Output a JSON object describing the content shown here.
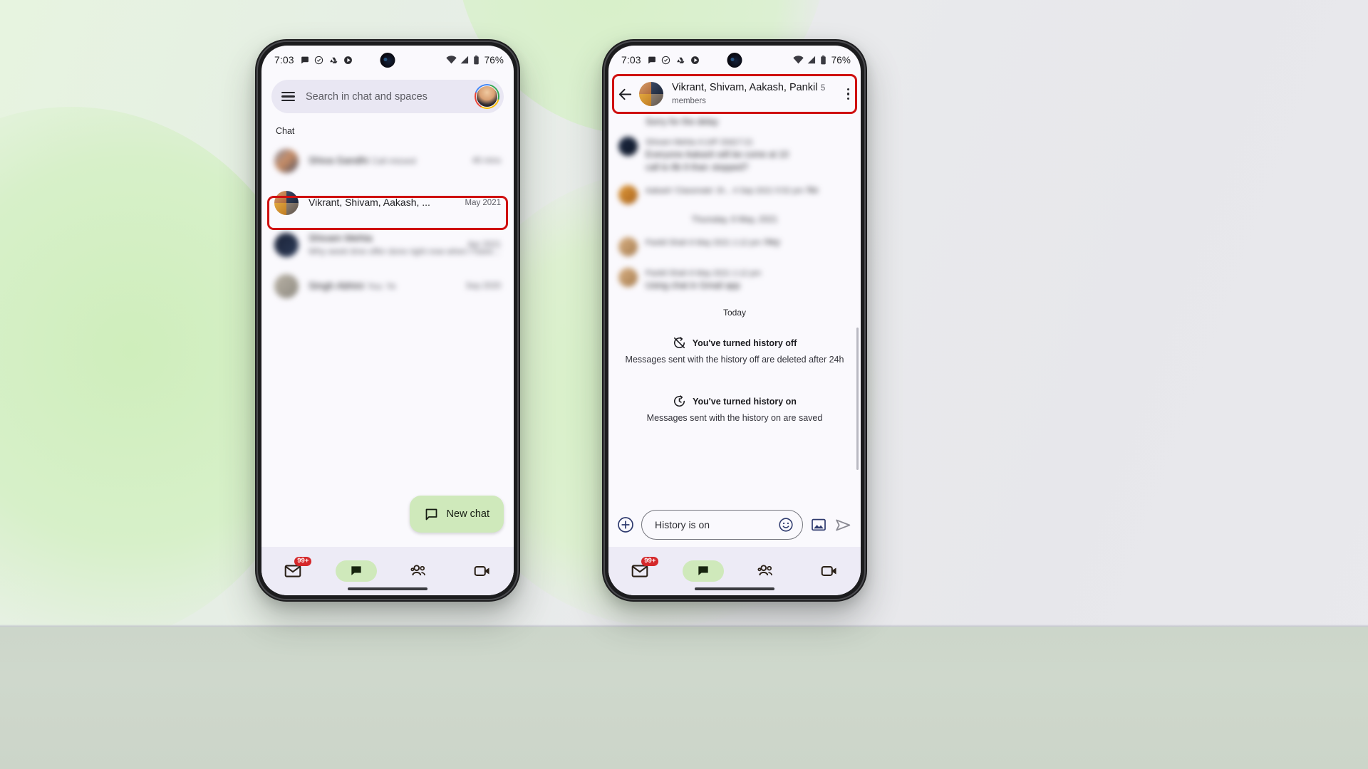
{
  "scene": {
    "background_start": "#e7f4e0",
    "background_end": "#e9e9ed",
    "floor_color": "#ccd6ca",
    "highlight_color": "#cf1010"
  },
  "status_bar": {
    "time": "7:03",
    "battery_percent": "76%",
    "icons_left": [
      "chat-bubble-icon",
      "clock-check-icon",
      "drive-icon",
      "play-icon"
    ],
    "icons_right": [
      "wifi-icon",
      "cellular-signal-icon",
      "battery-icon"
    ]
  },
  "phone_left": {
    "search": {
      "menu_icon": "hamburger-menu-icon",
      "placeholder": "Search in chat and spaces",
      "avatar_name": "account-avatar"
    },
    "section_label": "Chat",
    "rows": [
      {
        "title": "Shiva Gandhi",
        "subtitle": "Call missed",
        "time": "46 mins",
        "blurred": true,
        "highlighted": false
      },
      {
        "title": "Vikrant, Shivam, Aakash, ...",
        "subtitle": "",
        "time": "May 2021",
        "blurred": false,
        "highlighted": true
      },
      {
        "title": "Shivam Mehta",
        "subtitle": "Why week time offer done right now when I have...",
        "time": "Apr 2021",
        "blurred": true,
        "highlighted": false
      },
      {
        "title": "Singh Abhini",
        "subtitle": "You: Ye",
        "time": "Sep 2020",
        "blurred": true,
        "highlighted": false
      }
    ],
    "fab": {
      "icon": "new-chat-bubble-icon",
      "label": "New chat",
      "color": "#cfe9bb"
    },
    "bottom_nav": [
      {
        "name": "mail",
        "icon": "mail-icon",
        "badge": "99+",
        "active": false
      },
      {
        "name": "chat",
        "icon": "chat-bubble-filled-icon",
        "badge": "",
        "active": true
      },
      {
        "name": "spaces",
        "icon": "people-group-icon",
        "badge": "",
        "active": false
      },
      {
        "name": "meet",
        "icon": "video-camera-icon",
        "badge": "",
        "active": false
      }
    ]
  },
  "phone_right": {
    "header": {
      "back_icon": "back-arrow-icon",
      "title": "Vikrant, Shivam, Aakash, Pankil",
      "subtitle": "5 members",
      "overflow_icon": "kebab-menu-icon",
      "highlighted": true
    },
    "thread": {
      "top_partial_line": "Sorry for the delay",
      "messages": [
        {
          "sender_meta": "Shivam Mehta   4:14P  20d17:21",
          "lines": [
            "Everyone Aakash will be come at 10",
            "call to 8b 9 than",
            "stopped?"
          ],
          "avatar": "avatar-navy",
          "blurred": true
        },
        {
          "sender_meta": "Aakash 'Classmate' Jh...   4 Sep 2021 5:52 pm",
          "lines": [
            "No"
          ],
          "avatar": "avatar-orange",
          "blurred": true
        }
      ],
      "day_divider_blurred": "Thursday, 6 May, 2021",
      "messages_2": [
        {
          "sender_meta": "Pankil Shah  6 May 2021 1:12 pm",
          "lines": [
            "Hey"
          ],
          "avatar": "avatar-tan",
          "blurred": true
        },
        {
          "sender_meta": "Pankil Shah  6 May 2021 1:12 pm",
          "lines": [
            "Using chat in Gmail app"
          ],
          "avatar": "avatar-tan",
          "blurred": true
        }
      ],
      "day_divider": "Today",
      "system_messages": [
        {
          "icon": "history-off-icon",
          "title": "You've turned history off",
          "subtitle": "Messages sent with the history off are deleted after 24h"
        },
        {
          "icon": "history-on-icon",
          "title": "You've turned history on",
          "subtitle": "Messages sent with the history on are saved"
        }
      ]
    },
    "composer": {
      "add_icon": "plus-circle-icon",
      "placeholder": "History is on",
      "emoji_icon": "emoji-smile-icon",
      "image_icon": "image-icon",
      "send_icon": "send-icon"
    },
    "bottom_nav": [
      {
        "name": "mail",
        "icon": "mail-icon",
        "badge": "99+",
        "active": false
      },
      {
        "name": "chat",
        "icon": "chat-bubble-filled-icon",
        "badge": "",
        "active": true
      },
      {
        "name": "spaces",
        "icon": "people-group-icon",
        "badge": "",
        "active": false
      },
      {
        "name": "meet",
        "icon": "video-camera-icon",
        "badge": "",
        "active": false
      }
    ]
  }
}
